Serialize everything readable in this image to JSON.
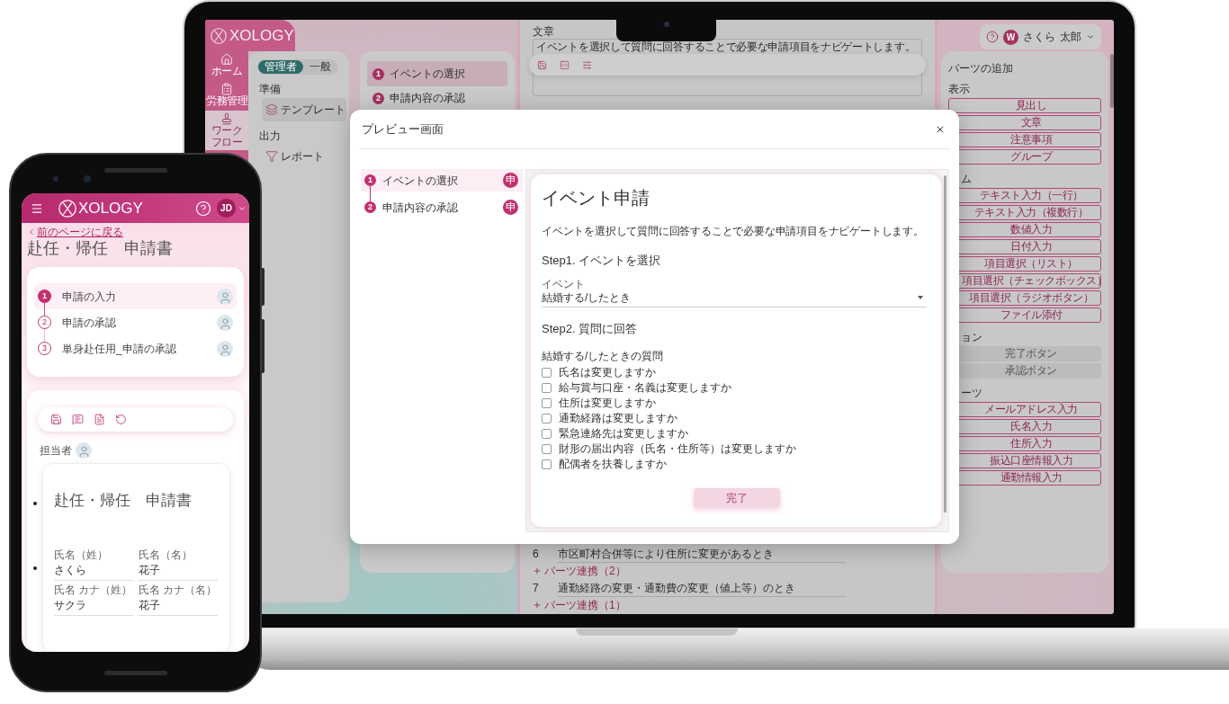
{
  "laptop": {
    "logo": "XOLOGY",
    "nav": [
      {
        "kind": "home",
        "label": "ホーム",
        "selected": false
      },
      {
        "kind": "labor",
        "label": "労務管理",
        "selected": false
      },
      {
        "kind": "workflow",
        "label": "ワークフロー",
        "selected": true
      }
    ],
    "mode_toggle": [
      {
        "label": "管理者",
        "selected": true
      },
      {
        "label": "一般",
        "selected": false
      }
    ],
    "menu": [
      {
        "title": "準備",
        "items": [
          {
            "kind": "template",
            "label": "テンプレート",
            "selected": true
          }
        ]
      },
      {
        "title": "出力",
        "items": [
          {
            "kind": "report",
            "label": "レポート",
            "selected": false
          }
        ]
      }
    ],
    "steps": [
      {
        "number": "1",
        "label": "イベントの選択",
        "selected": true
      },
      {
        "number": "2",
        "label": "申請内容の承認",
        "selected": false
      }
    ],
    "editor": {
      "field_label": "文章",
      "field_value": "イベントを選択して質問に回答することで必要な申請項目をナビゲートします。",
      "items": [
        {
          "number": "6",
          "title": "市区町村合併等により住所に変更があるとき",
          "link": "パーツ連携（2）"
        },
        {
          "number": "7",
          "title": "通勤経路の変更・通勤費の変更（値上等）のとき",
          "link": "パーツ連携（1）"
        }
      ]
    },
    "user": {
      "initial": "W",
      "name_parts": [
        "さくら",
        "太郎"
      ]
    },
    "parts": {
      "title": "パーツの追加",
      "groups": [
        {
          "title": "表示",
          "cut": false,
          "buttons": [
            {
              "label": "見出し",
              "disabled": false
            },
            {
              "label": "文章",
              "disabled": false
            },
            {
              "label": "注意事項",
              "disabled": false
            },
            {
              "label": "グループ",
              "disabled": false
            }
          ]
        },
        {
          "title": "ム",
          "cut": true,
          "buttons": [
            {
              "label": "テキスト入力（一行）",
              "disabled": false
            },
            {
              "label": "テキスト入力（複数行）",
              "disabled": false
            },
            {
              "label": "数値入力",
              "disabled": false
            },
            {
              "label": "日付入力",
              "disabled": false
            },
            {
              "label": "項目選択（リスト）",
              "disabled": false
            },
            {
              "label": "項目選択（チェックボックス）",
              "disabled": false
            },
            {
              "label": "項目選択（ラジオボタン）",
              "disabled": false
            },
            {
              "label": "ファイル添付",
              "disabled": false
            }
          ]
        },
        {
          "title": "ョン",
          "cut": true,
          "buttons": [
            {
              "label": "完了ボタン",
              "disabled": true
            },
            {
              "label": "承認ボタン",
              "disabled": true
            }
          ]
        },
        {
          "title": "ーツ",
          "cut": true,
          "buttons": [
            {
              "label": "メールアドレス入力",
              "disabled": false
            },
            {
              "label": "氏名入力",
              "disabled": false
            },
            {
              "label": "住所入力",
              "disabled": false
            },
            {
              "label": "振込口座情報入力",
              "disabled": false
            },
            {
              "label": "通勤情報入力",
              "disabled": false
            }
          ]
        }
      ]
    }
  },
  "modal": {
    "title": "プレビュー画面",
    "steps": [
      {
        "number": "1",
        "label": "イベントの選択",
        "badge": "申",
        "selected": true
      },
      {
        "number": "2",
        "label": "申請内容の承認",
        "badge": "申",
        "selected": false
      }
    ],
    "form": {
      "title": "イベント申請",
      "description": "イベントを選択して質問に回答することで必要な申請項目をナビゲートします。",
      "step1": "Step1. イベントを選択",
      "select": {
        "label": "イベント",
        "value": "結婚する/したとき"
      },
      "step2": "Step2. 質問に回答",
      "question_group": "結婚する/したときの質問",
      "questions": [
        {
          "label": "氏名は変更しますか",
          "checked": false
        },
        {
          "label": "給与賞与口座・名義は変更しますか",
          "checked": false
        },
        {
          "label": "住所は変更しますか",
          "checked": false
        },
        {
          "label": "通勤経路は変更しますか",
          "checked": false
        },
        {
          "label": "緊急連絡先は変更しますか",
          "checked": false
        },
        {
          "label": "財形の届出内容（氏名・住所等）は変更しますか",
          "checked": false
        },
        {
          "label": "配偶者を扶養しますか",
          "checked": false
        }
      ],
      "submit": {
        "label": "完了",
        "disabled": true
      }
    }
  },
  "phone": {
    "logo": "XOLOGY",
    "avatar": "JD",
    "back_link": "前のページに戻る",
    "title": "赴任・帰任　申請書",
    "steps": [
      {
        "number": "1",
        "label": "申請の入力",
        "selected": true
      },
      {
        "number": "2",
        "label": "申請の承認",
        "selected": false
      },
      {
        "number": "3",
        "label": "単身赴任用_申請の承認",
        "selected": false
      }
    ],
    "assignee_label": "担当者",
    "form": {
      "title": "赴任・帰任　申請書",
      "fields": [
        {
          "label": "氏名（姓）",
          "value": "さくら"
        },
        {
          "label": "氏名（名）",
          "value": "花子"
        },
        {
          "label": "氏名 カナ（姓）",
          "value": "サクラ"
        },
        {
          "label": "氏名 カナ（名）",
          "value": "花子"
        }
      ]
    }
  }
}
